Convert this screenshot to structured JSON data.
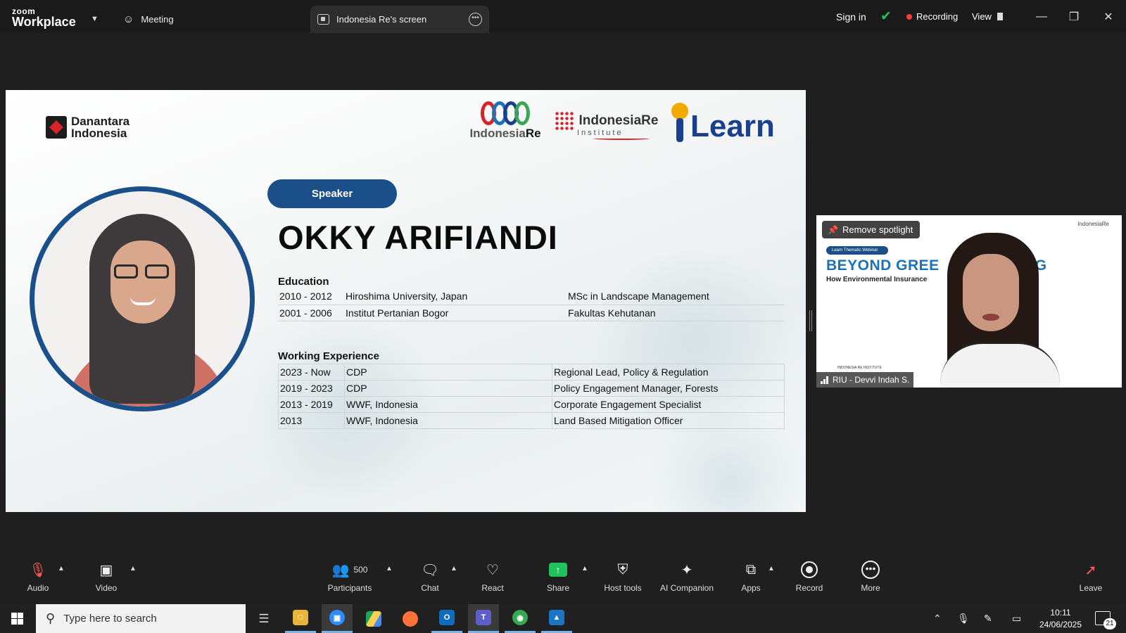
{
  "window": {
    "brand_top": "zoom",
    "brand_bottom": "Workplace",
    "tabs": [
      {
        "label": "Meeting",
        "icon": "meeting-icon"
      },
      {
        "label": "Indonesia Re's screen",
        "icon": "screen-share-icon"
      }
    ],
    "sign_in": "Sign in",
    "recording": "Recording",
    "view": "View"
  },
  "slide": {
    "logos": {
      "danantara_line1": "Danantara",
      "danantara_line2": "Indonesia",
      "indonesia_re_prefix": "Indonesia",
      "indonesia_re_suffix": "Re",
      "indonesia_re_institute_name": "IndonesiaRe",
      "indonesia_re_institute_sub": "Institute",
      "learn": "Learn"
    },
    "speaker_label": "Speaker",
    "speaker_name": "OKKY ARIFIANDI",
    "education_heading": "Education",
    "education": [
      {
        "years": "2010 - 2012",
        "institution": "Hiroshima University, Japan",
        "degree": "MSc in Landscape Management"
      },
      {
        "years": "2001 - 2006",
        "institution": "Institut Pertanian Bogor",
        "degree": "Fakultas Kehutanan"
      }
    ],
    "work_heading": "Working Experience",
    "work": [
      {
        "years": "2023 - Now",
        "org": "CDP",
        "role": "Regional Lead, Policy & Regulation"
      },
      {
        "years": "2019 - 2023",
        "org": "CDP",
        "role": "Policy Engagement Manager, Forests"
      },
      {
        "years": "2013 - 2019",
        "org": "WWF, Indonesia",
        "role": "Corporate Engagement Specialist"
      },
      {
        "years": "2013",
        "org": "WWF, Indonesia",
        "role": "Land Based Mitigation Officer"
      }
    ]
  },
  "speaker_tile": {
    "remove_spotlight": "Remove spotlight",
    "participant_name": "RIU - Devvi Indah S.",
    "bg_badge": "Learn Thematic Webinar",
    "bg_title": "BEYOND GREE",
    "bg_title_end": "G",
    "bg_subtitle": "How Environmental Insurance",
    "bg_logo": "IndonesiaRe",
    "bg_footer": "INDONESIA RE INSTITUTE"
  },
  "controls": {
    "audio": "Audio",
    "video": "Video",
    "participants": "Participants",
    "participants_count": "500",
    "chat": "Chat",
    "react": "React",
    "share": "Share",
    "host_tools": "Host tools",
    "ai_companion": "AI Companion",
    "apps": "Apps",
    "record": "Record",
    "more": "More",
    "leave": "Leave"
  },
  "taskbar": {
    "search_placeholder": "Type here to search",
    "time": "10:11",
    "date": "24/06/2025",
    "notifications": "21"
  },
  "colors": {
    "accent_blue": "#1b4f8a",
    "recording_red": "#ff3b3b",
    "secure_green": "#21c25e"
  }
}
